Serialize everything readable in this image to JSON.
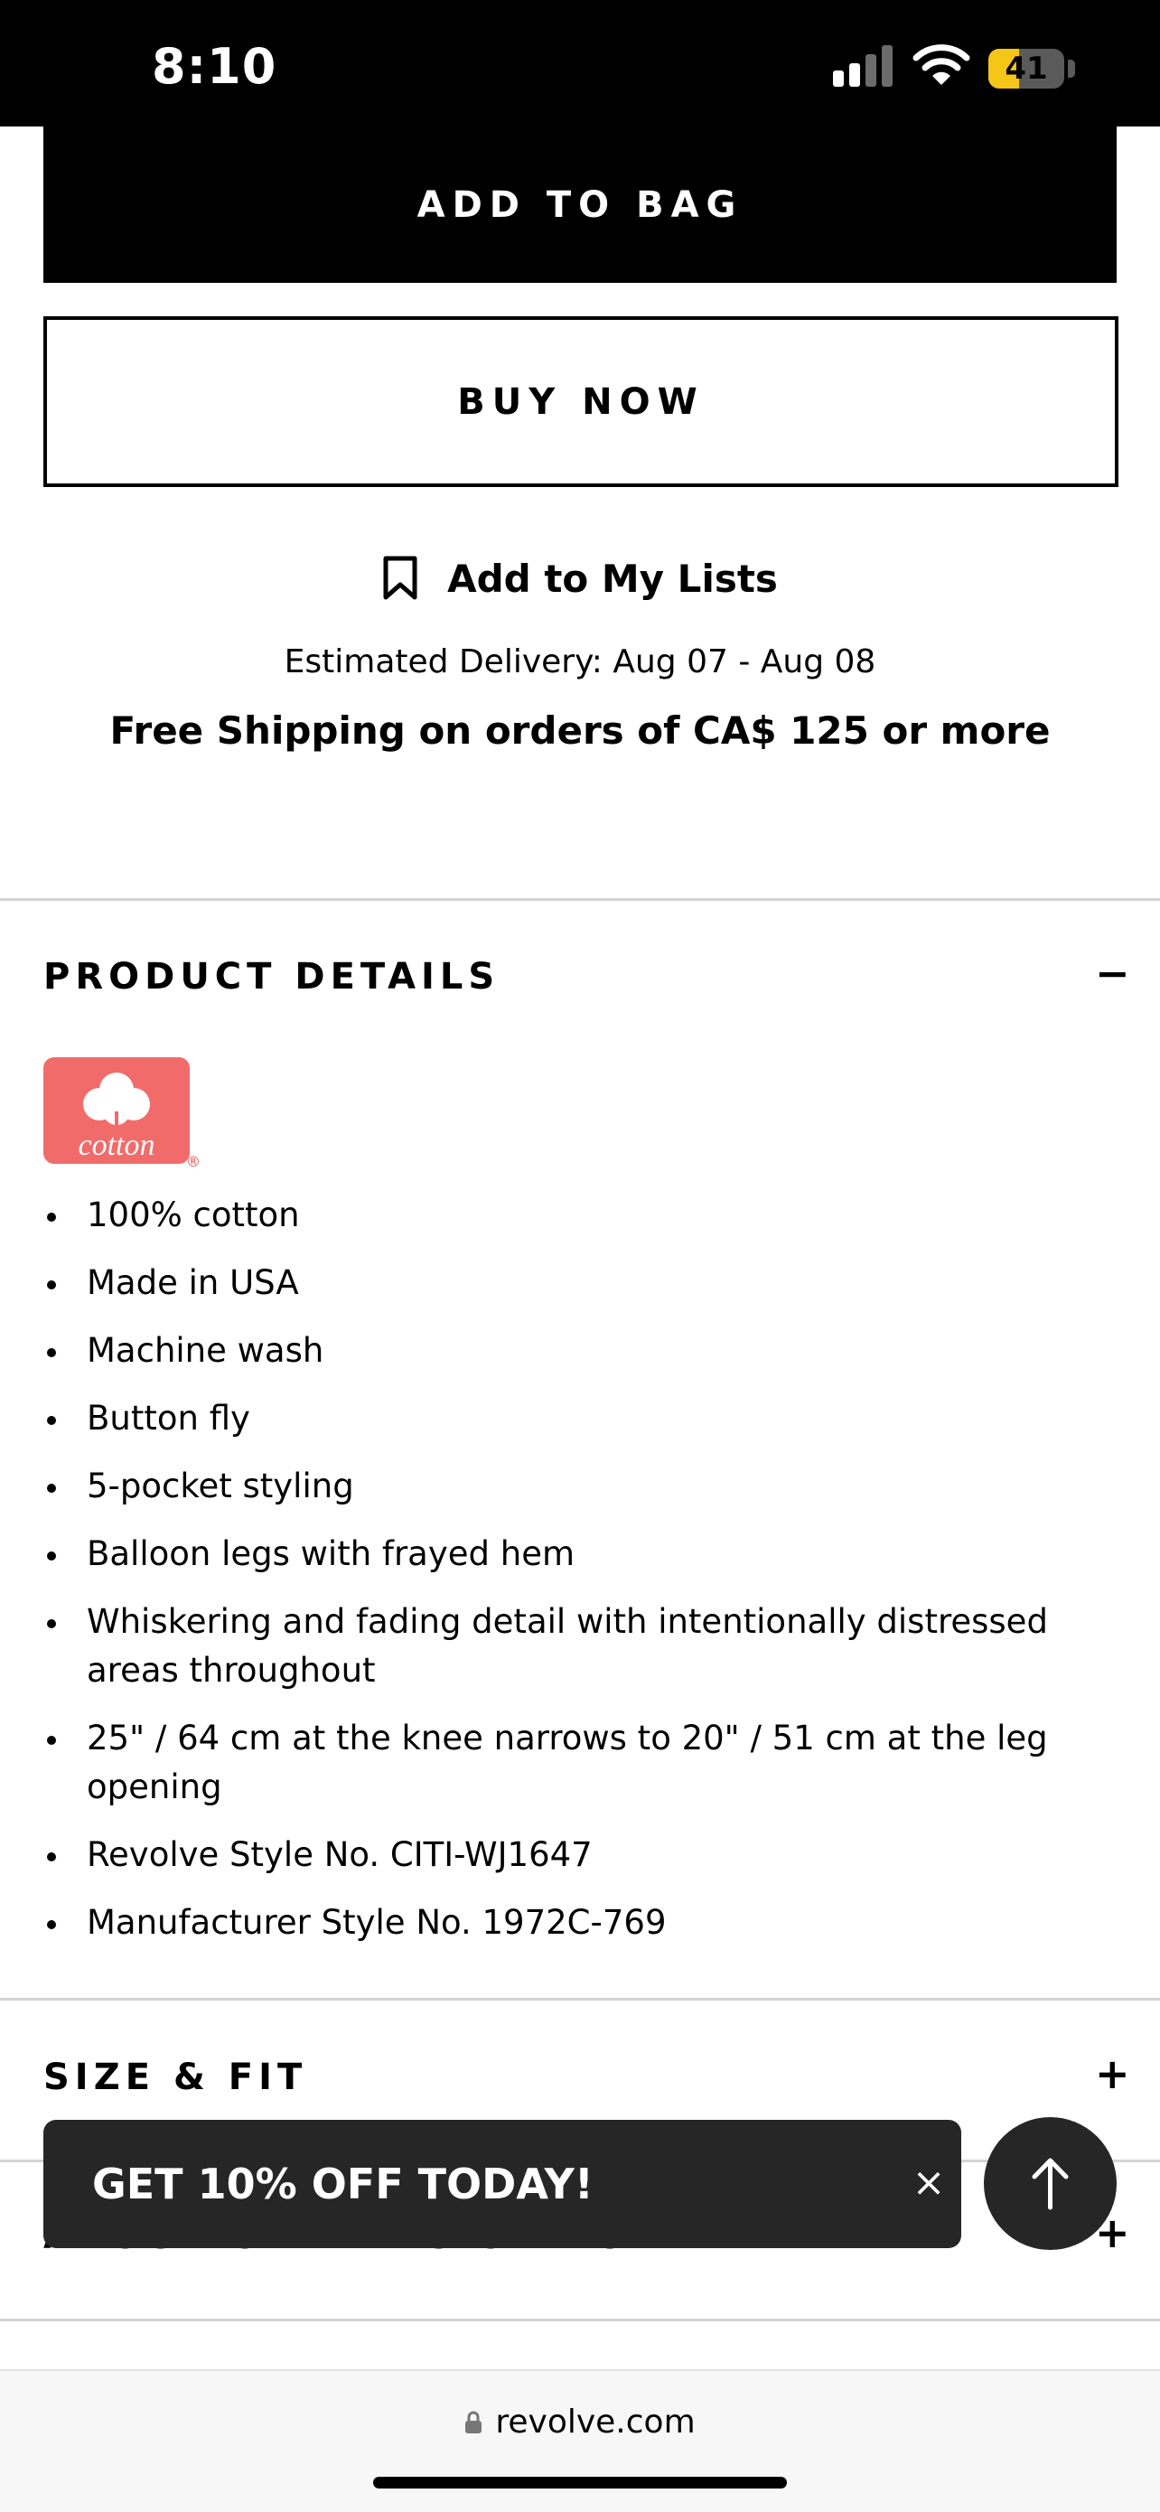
{
  "status_bar": {
    "time": "8:10",
    "battery_level": "41",
    "icons": [
      "signal-icon",
      "wifi-icon",
      "battery-icon"
    ]
  },
  "actions": {
    "add_to_bag": "ADD TO BAG",
    "buy_now": "BUY NOW",
    "add_to_lists": "Add to My Lists",
    "lists_icon": "bookmark-icon"
  },
  "delivery": {
    "estimate": "Estimated Delivery: Aug 07 - Aug 08",
    "free_shipping": "Free Shipping on orders of CA$ 125 or more"
  },
  "product_details": {
    "title": "PRODUCT DETAILS",
    "toggle": "−",
    "badge_text": "cotton",
    "badge_color": "#f26b6b",
    "items": [
      "100% cotton",
      "Made in USA",
      "Machine wash",
      "Button fly",
      "5-pocket styling",
      "Balloon legs with frayed hem",
      "Whiskering and fading detail with intentionally distressed areas throughout",
      "25\" / 64 cm at the knee narrows to 20\" / 51 cm at the leg opening",
      "Revolve Style No. CITI-WJ1647",
      "Manufacturer Style No. 1972C-769"
    ]
  },
  "size_fit": {
    "title": "SIZE & FIT",
    "toggle": "+"
  },
  "about": {
    "title": "ABOUT CITIZENS OF HUMANITY",
    "toggle": "+"
  },
  "promo": {
    "text": "GET 10% OFF TODAY!",
    "close": "×"
  },
  "browser": {
    "url": "revolve.com"
  }
}
